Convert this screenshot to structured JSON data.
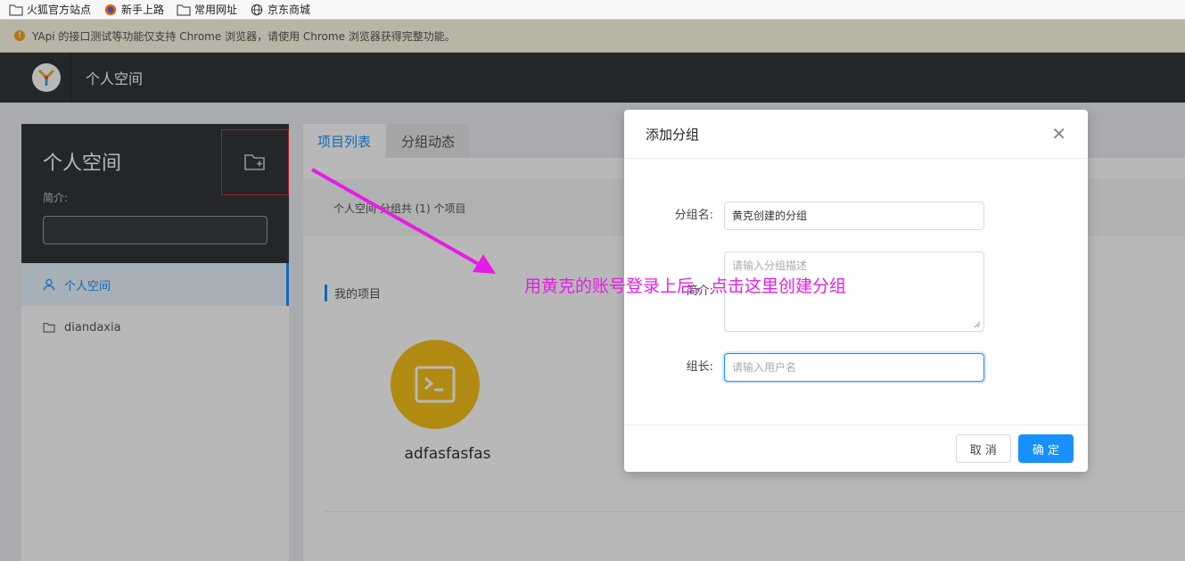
{
  "bookmarks": [
    {
      "label": "火狐官方站点",
      "icon": "folder-icon"
    },
    {
      "label": "新手上路",
      "icon": "firefox-icon"
    },
    {
      "label": "常用网址",
      "icon": "folder-icon"
    },
    {
      "label": "京东商城",
      "icon": "globe-icon"
    }
  ],
  "notice": {
    "text": "YApi 的接口测试等功能仅支持 Chrome 浏览器，请使用 Chrome 浏览器获得完整功能。"
  },
  "header": {
    "title": "个人空间"
  },
  "sidebar": {
    "title": "个人空间",
    "intro_label": "简介:",
    "items": [
      {
        "label": "个人空间",
        "icon": "user-icon"
      },
      {
        "label": "diandaxia",
        "icon": "folder-icon"
      }
    ]
  },
  "main": {
    "tabs": [
      {
        "label": "项目列表"
      },
      {
        "label": "分组动态"
      }
    ],
    "summary": "个人空间 分组共 (1) 个项目",
    "section_title": "我的项目",
    "project": {
      "name": "adfasfasfas"
    }
  },
  "modal": {
    "title": "添加分组",
    "fields": {
      "name_label": "分组名:",
      "name_value": "黄克创建的分组",
      "desc_label": "简介:",
      "desc_placeholder": "请输入分组描述",
      "owner_label": "组长:",
      "owner_placeholder": "请输入用户名"
    },
    "cancel_label": "取 消",
    "ok_label": "确 定"
  },
  "annotation": {
    "text": "用黄克的账号登录上后，点击这里创建分组",
    "color": "#e61ce6"
  },
  "colors": {
    "accent": "#1890ff",
    "header": "#32363a",
    "project_icon": "#f5c018"
  }
}
